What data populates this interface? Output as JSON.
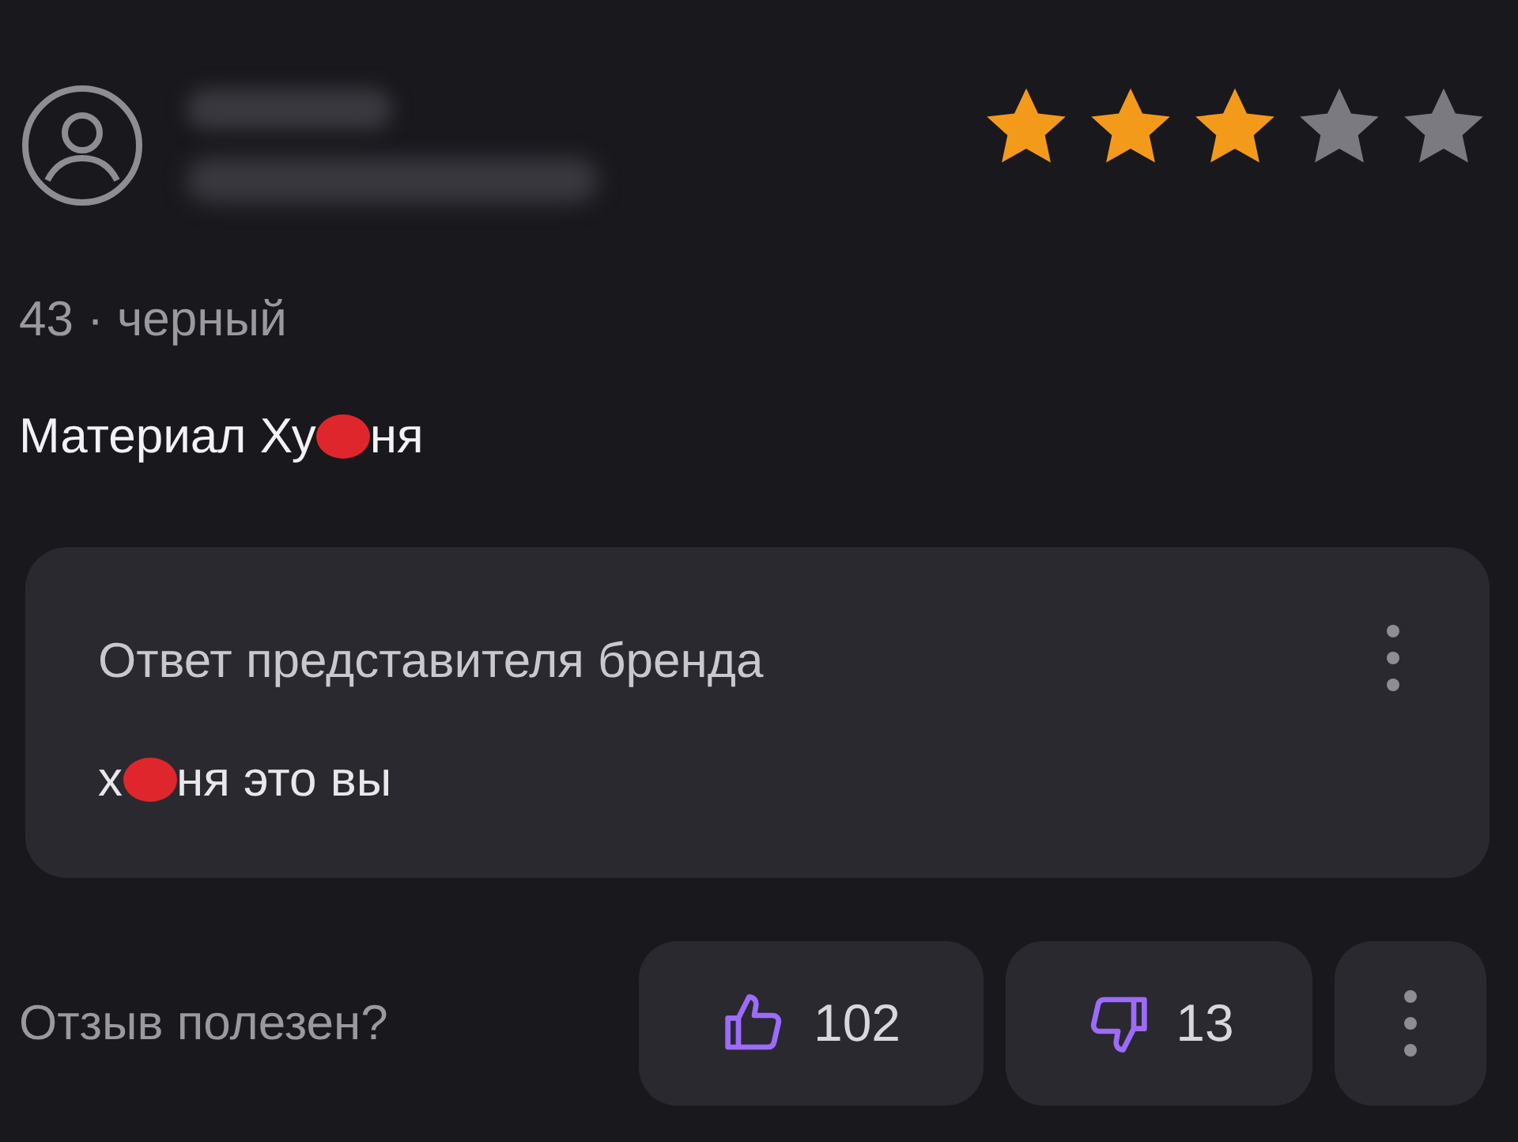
{
  "review": {
    "stars": 3,
    "variant": "43 · черный",
    "text_parts": [
      "Материал Ху",
      "ня"
    ]
  },
  "brand_reply": {
    "title": "Ответ представителя бренда",
    "text_parts": [
      "х",
      "ня это вы"
    ]
  },
  "helpful": {
    "question": "Отзыв полезен?",
    "likes": "102",
    "dislikes": "13"
  }
}
